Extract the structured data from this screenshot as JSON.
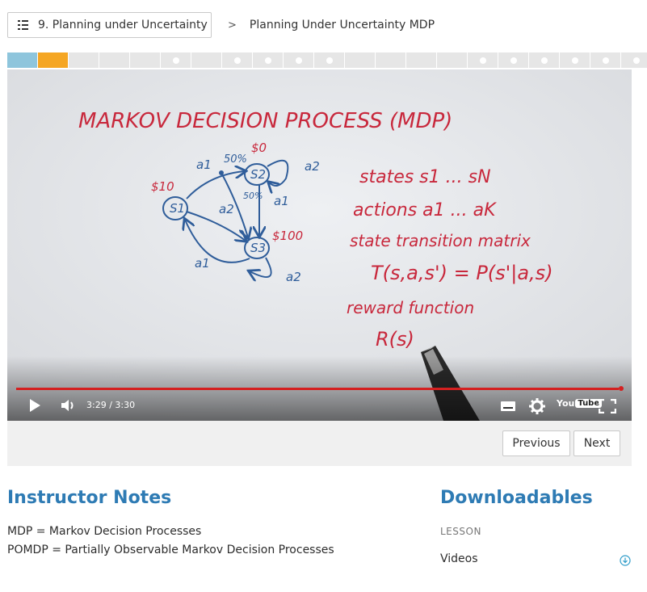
{
  "header": {
    "lesson_label": "9. Planning under Uncertainty",
    "breadcrumb_separator": ">",
    "breadcrumb_title": "Planning Under Uncertainty MDP"
  },
  "progress": {
    "segments": [
      {
        "state": "complete",
        "color": "#8ec5dc",
        "dot": false
      },
      {
        "state": "current",
        "color": "#f5a623",
        "dot": false
      },
      {
        "state": "pending",
        "color": "#e6e6e6",
        "dot": false
      },
      {
        "state": "pending",
        "color": "#e6e6e6",
        "dot": false
      },
      {
        "state": "pending",
        "color": "#e6e6e6",
        "dot": false
      },
      {
        "state": "pending",
        "color": "#e6e6e6",
        "dot": true
      },
      {
        "state": "pending",
        "color": "#e6e6e6",
        "dot": false
      },
      {
        "state": "pending",
        "color": "#e6e6e6",
        "dot": true
      },
      {
        "state": "pending",
        "color": "#e6e6e6",
        "dot": true
      },
      {
        "state": "pending",
        "color": "#e6e6e6",
        "dot": true
      },
      {
        "state": "pending",
        "color": "#e6e6e6",
        "dot": true
      },
      {
        "state": "pending",
        "color": "#e6e6e6",
        "dot": false
      },
      {
        "state": "pending",
        "color": "#e6e6e6",
        "dot": false
      },
      {
        "state": "pending",
        "color": "#e6e6e6",
        "dot": false
      },
      {
        "state": "pending",
        "color": "#e6e6e6",
        "dot": false
      },
      {
        "state": "pending",
        "color": "#e6e6e6",
        "dot": true
      },
      {
        "state": "pending",
        "color": "#e6e6e6",
        "dot": true
      },
      {
        "state": "pending",
        "color": "#e6e6e6",
        "dot": true
      },
      {
        "state": "pending",
        "color": "#e6e6e6",
        "dot": true
      },
      {
        "state": "pending",
        "color": "#e6e6e6",
        "dot": true
      },
      {
        "state": "pending",
        "color": "#e6e6e6",
        "dot": true
      }
    ]
  },
  "video": {
    "board": {
      "title": "MARKOV DECISION PROCESS (MDP)",
      "states_line": "states s1 ... sN",
      "actions_line": "actions a1 ... aK",
      "transition_line": "state transition matrix",
      "transition_formula": "T(s,a,s') = P(s'|a,s)",
      "reward_line": "reward function",
      "reward_formula": "R(s)",
      "node_s1": "S1",
      "node_s2": "S2",
      "node_s3": "S3",
      "edge_a1_top": "a1",
      "edge_50pct": "50%",
      "edge_a2_s2": "a2",
      "edge_a2_mid": "a2",
      "edge_50pct_mid": "50%",
      "edge_a1_right": "a1",
      "edge_a1_bottom": "a1",
      "edge_a2_s3": "a2",
      "reward_s1": "$10",
      "reward_s2": "$0",
      "reward_s3": "$100"
    },
    "time_display": "3:29 / 3:30",
    "played_fraction": 0.995,
    "youtube_label": "You",
    "youtube_box": "Tube"
  },
  "nav": {
    "previous_label": "Previous",
    "next_label": "Next"
  },
  "instructor_notes": {
    "title": "Instructor Notes",
    "lines": [
      "MDP = Markov Decision Processes",
      "POMDP = Partially Observable Markov Decision Processes"
    ]
  },
  "downloadables": {
    "title": "Downloadables",
    "section_label": "LESSON",
    "item_label": "Videos"
  },
  "colors": {
    "accent_blue": "#2e7bb4",
    "progress_done": "#8ec5dc",
    "progress_current": "#f5a623",
    "scrub_red": "#d42020",
    "ink_red": "#c8283c",
    "ink_blue": "#2f5d9a"
  }
}
